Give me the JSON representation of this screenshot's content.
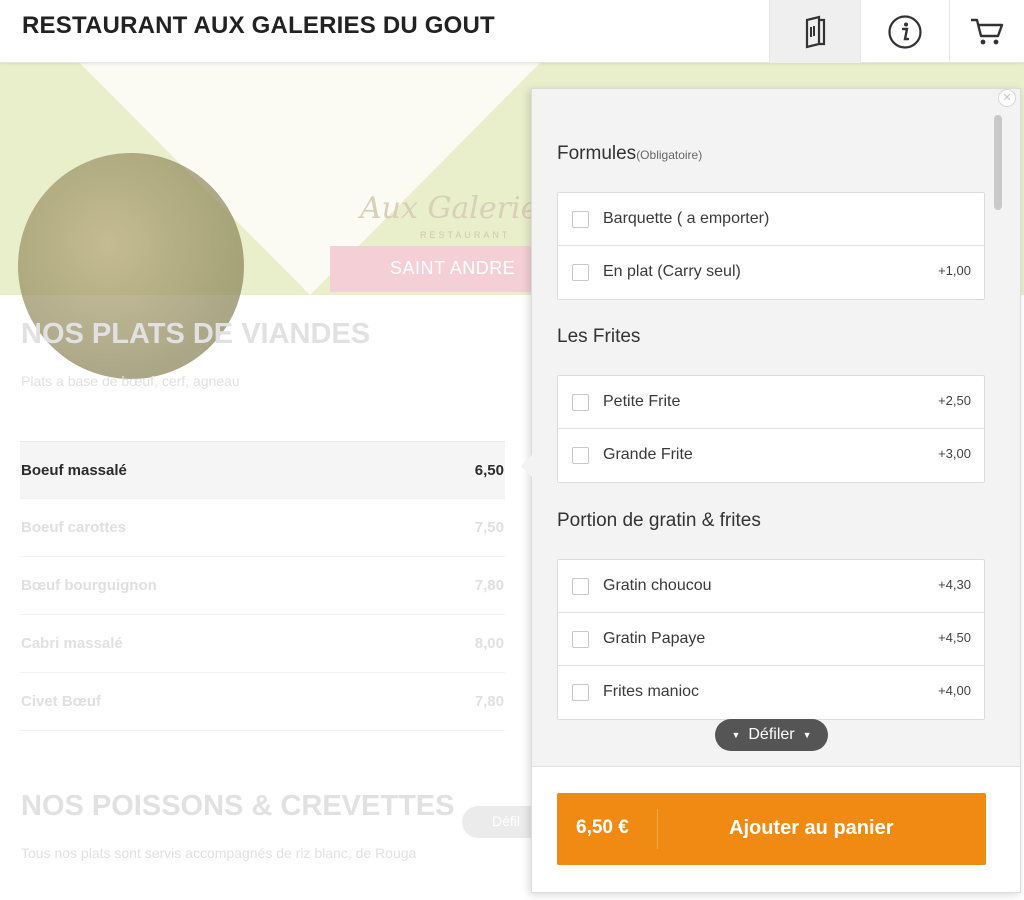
{
  "header": {
    "title": "RESTAURANT AUX GALERIES DU GOUT"
  },
  "banner": {
    "brand": "Aux Galeries",
    "brand_sub": "RESTAURANT",
    "location": "SAINT ANDRE"
  },
  "section1": {
    "title": "NOS PLATS DE VIANDES",
    "subtitle": "Plats a base de bœuf, cerf, agneau",
    "items": [
      {
        "name": "Boeuf massalé",
        "price": "6,50"
      },
      {
        "name": "Boeuf carottes",
        "price": "7,50"
      },
      {
        "name": "Bœuf bourguignon",
        "price": "7,80"
      },
      {
        "name": "Cabri massalé",
        "price": "8,00"
      },
      {
        "name": "Civet Bœuf",
        "price": "7,80"
      }
    ]
  },
  "section2": {
    "title": "NOS POISSONS & CREVETTES",
    "subtitle": "Tous nos plats sont servis accompagnés de riz blanc, de Rouga",
    "scroll_label": "Défil"
  },
  "panel": {
    "groups": [
      {
        "title": "Formules",
        "note": "(Obligatoire)",
        "options": [
          {
            "label": "Barquette ( a emporter)",
            "price": ""
          },
          {
            "label": "En plat (Carry seul)",
            "price": "+1,00"
          }
        ]
      },
      {
        "title": "Les Frites",
        "note": "",
        "options": [
          {
            "label": "Petite Frite",
            "price": "+2,50"
          },
          {
            "label": "Grande Frite",
            "price": "+3,00"
          }
        ]
      },
      {
        "title": "Portion de gratin & frites",
        "note": "",
        "options": [
          {
            "label": "Gratin choucou",
            "price": "+4,30"
          },
          {
            "label": "Gratin Papaye",
            "price": "+4,50"
          },
          {
            "label": "Frites manioc",
            "price": "+4,00"
          }
        ]
      }
    ],
    "scroll_label": "Défiler",
    "add_button": {
      "price": "6,50 €",
      "label": "Ajouter au panier"
    },
    "accent_color": "#f08a12"
  }
}
